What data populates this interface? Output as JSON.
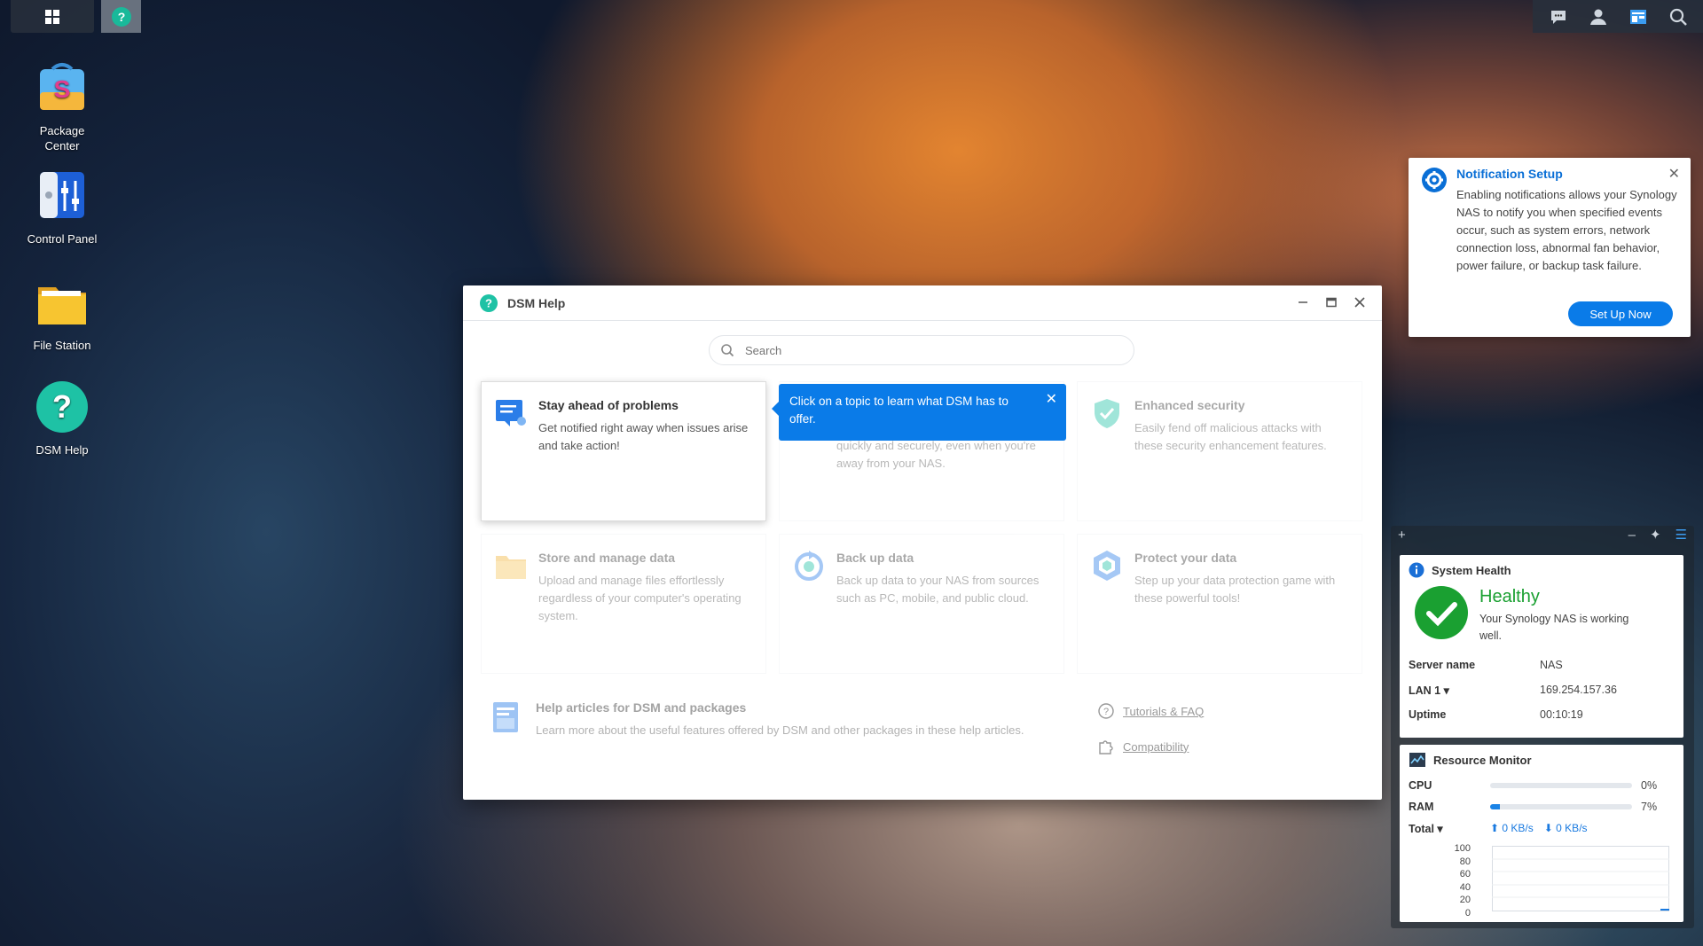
{
  "taskbar": {
    "main_icon": "grid-icon",
    "help_icon": "help-circle-icon",
    "right_icons": [
      "chat-icon",
      "user-icon",
      "widgets-icon",
      "search-icon"
    ]
  },
  "desktop": {
    "items": [
      {
        "label_lines": [
          "Package",
          "Center"
        ],
        "icon": "package-center-icon"
      },
      {
        "label_lines": [
          "Control Panel"
        ],
        "icon": "control-panel-icon"
      },
      {
        "label_lines": [
          "File Station"
        ],
        "icon": "file-station-icon"
      },
      {
        "label_lines": [
          "DSM Help"
        ],
        "icon": "dsm-help-icon"
      }
    ]
  },
  "dsm_help": {
    "title": "DSM Help",
    "search_placeholder": "Search",
    "tooltip": "Click on a topic to learn what DSM has to offer.",
    "cards": [
      {
        "title": "Stay ahead of problems",
        "desc": "Get notified right away when issues arise and take action!"
      },
      {
        "title": "",
        "desc": "quickly and securely, even when you're away from your NAS."
      },
      {
        "title": "Enhanced security",
        "desc": "Easily fend off malicious attacks with these security enhancement features."
      },
      {
        "title": "Store and manage data",
        "desc": "Upload and manage files effortlessly regardless of your computer's operating system."
      },
      {
        "title": "Back up data",
        "desc": "Back up data to your NAS from sources such as PC, mobile, and public cloud."
      },
      {
        "title": "Protect your data",
        "desc": "Step up your data protection game with these powerful tools!"
      }
    ],
    "articles": {
      "title": "Help articles for DSM and packages",
      "desc": "Learn more about the useful features offered by DSM and other packages in these help articles."
    },
    "links": {
      "tutorials": "Tutorials & FAQ",
      "compatibility": "Compatibility"
    }
  },
  "notification": {
    "title": "Notification Setup",
    "body": "Enabling notifications allows your Synology NAS to notify you when specified events occur, such as system errors, network connection loss, abnormal fan behavior, power failure, or backup task failure.",
    "button": "Set Up Now"
  },
  "system_health": {
    "title": "System Health",
    "status": "Healthy",
    "status_desc": "Your Synology NAS is working well.",
    "rows": [
      {
        "key": "Server name",
        "value": "NAS"
      },
      {
        "key": "LAN 1 ▾",
        "value": "169.254.157.36"
      },
      {
        "key": "Uptime",
        "value": "00:10:19"
      }
    ]
  },
  "resource_monitor": {
    "title": "Resource Monitor",
    "cpu": {
      "label": "CPU",
      "percent": 0,
      "text": "0%"
    },
    "ram": {
      "label": "RAM",
      "percent": 7,
      "text": "7%"
    },
    "total": {
      "label": "Total ▾",
      "up": "0 KB/s",
      "down": "0 KB/s"
    },
    "y_ticks": [
      "100",
      "80",
      "60",
      "40",
      "20",
      "0"
    ]
  },
  "colors": {
    "accent": "#0a7be8",
    "healthy": "#1aa031"
  }
}
